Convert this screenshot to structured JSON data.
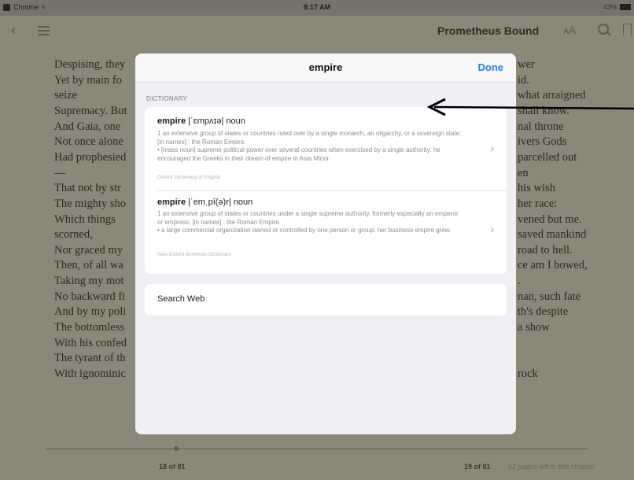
{
  "status_bar": {
    "app_name": "Chrome",
    "time": "8:17 AM",
    "battery": "43%"
  },
  "nav": {
    "book_title": "Prometheus Bound",
    "font_button": "AA"
  },
  "book": {
    "lines_left": [
      "Despising, they",
      "Yet by main fo",
      "seize",
      "Supremacy. But",
      "And Gaia, one",
      "Not once alone",
      "Had prophesied",
      "—",
      "That not by str",
      "The mighty sho",
      "Which  things",
      "scorned,",
      "Nor graced my",
      "Then, of all wa",
      "Taking my mot",
      "No backward fi",
      "And by my poli",
      "The bottomless",
      "With his confed",
      "The tyrant of th",
      "With ignominic"
    ],
    "lines_right": [
      "wer",
      "id.",
      "what arraigned",
      "shall know.",
      "nal throne",
      "ivers Gods",
      "parcelled out",
      "en",
      "his wish",
      "her race:",
      "vened but me.",
      "saved mankind",
      "road to hell.",
      "ce am I bowed,",
      ".",
      "nan, such fate",
      "th's despite",
      "a show",
      "rock"
    ]
  },
  "footer": {
    "left_page": "18 of 81",
    "right_page": "19 of 81",
    "pages_left": "62 pages left in this chapter",
    "progress": 0.24
  },
  "popup": {
    "title": "empire",
    "done_label": "Done",
    "section_label": "DICTIONARY",
    "entries": [
      {
        "headword": "empire",
        "pron": " |ˈɛmpʌɪə| noun",
        "definition": "1 an extensive group of states or countries ruled over by a single monarch, an oligarchy, or a sovereign state: [in names] : the Roman Empire.\n• [mass noun] supreme political power over several countries when exercised by a single authority: he encouraged the Greeks in their dream of empire in Asia Minor.",
        "source": "Oxford Dictionary of English"
      },
      {
        "headword": "empire",
        "pron": " |ˈemˌpī(ə)r| noun",
        "definition": "1 an extensive group of states or countries under a single supreme authority, formerly especially an emperor or empress: [in names] : the Roman Empire.\n• a large commercial organization owned or controlled by one person or group: her business empire grew.",
        "source": "New Oxford American Dictionary"
      }
    ],
    "search_web_label": "Search Web"
  }
}
